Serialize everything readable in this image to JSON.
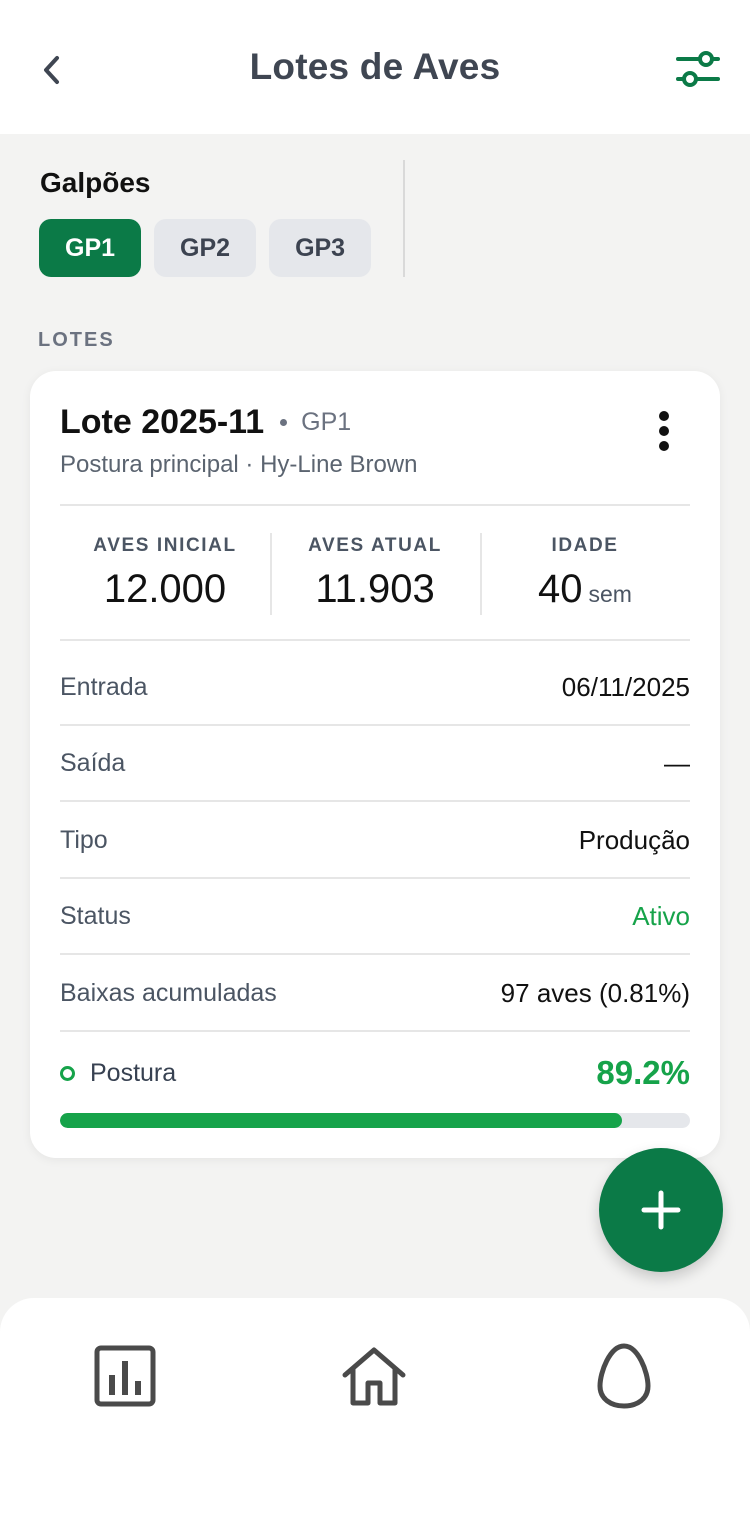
{
  "header": {
    "title": "Lotes de Aves",
    "back_icon": "chevron-left-icon",
    "filter_icon": "sliders-icon"
  },
  "galpoes": {
    "title": "Galpões",
    "chips": [
      {
        "label": "GP1",
        "active": true
      },
      {
        "label": "GP2",
        "active": false
      },
      {
        "label": "GP3",
        "active": false
      }
    ]
  },
  "lotes_label": "LOTES",
  "card": {
    "name": "Lote 2025-11",
    "shed": "GP1",
    "subtitle": "Postura principal · Hy-Line Brown",
    "stats": [
      {
        "label": "AVES INICIAL",
        "value": "12.000",
        "unit": ""
      },
      {
        "label": "AVES ATUAL",
        "value": "11.903",
        "unit": ""
      },
      {
        "label": "IDADE",
        "value": "40",
        "unit": "sem"
      }
    ],
    "rows": [
      {
        "label": "Entrada",
        "value": "06/11/2025"
      },
      {
        "label": "Saída",
        "value": "—"
      },
      {
        "label": "Tipo",
        "value": "Produção"
      },
      {
        "label": "Status",
        "value": "Ativo"
      },
      {
        "label": "Baixas acumuladas",
        "value": "97 aves (0.81%)"
      }
    ],
    "postura": {
      "label": "Postura",
      "value": "89.2%",
      "progress": 0.892
    }
  },
  "fab": {
    "icon": "plus-icon"
  },
  "bottom_nav": [
    {
      "icon": "bar-chart-icon"
    },
    {
      "icon": "home-icon"
    },
    {
      "icon": "egg-icon"
    }
  ],
  "colors": {
    "primary": "#0b7a47",
    "success": "#16a34a",
    "background": "#f3f3f2"
  }
}
